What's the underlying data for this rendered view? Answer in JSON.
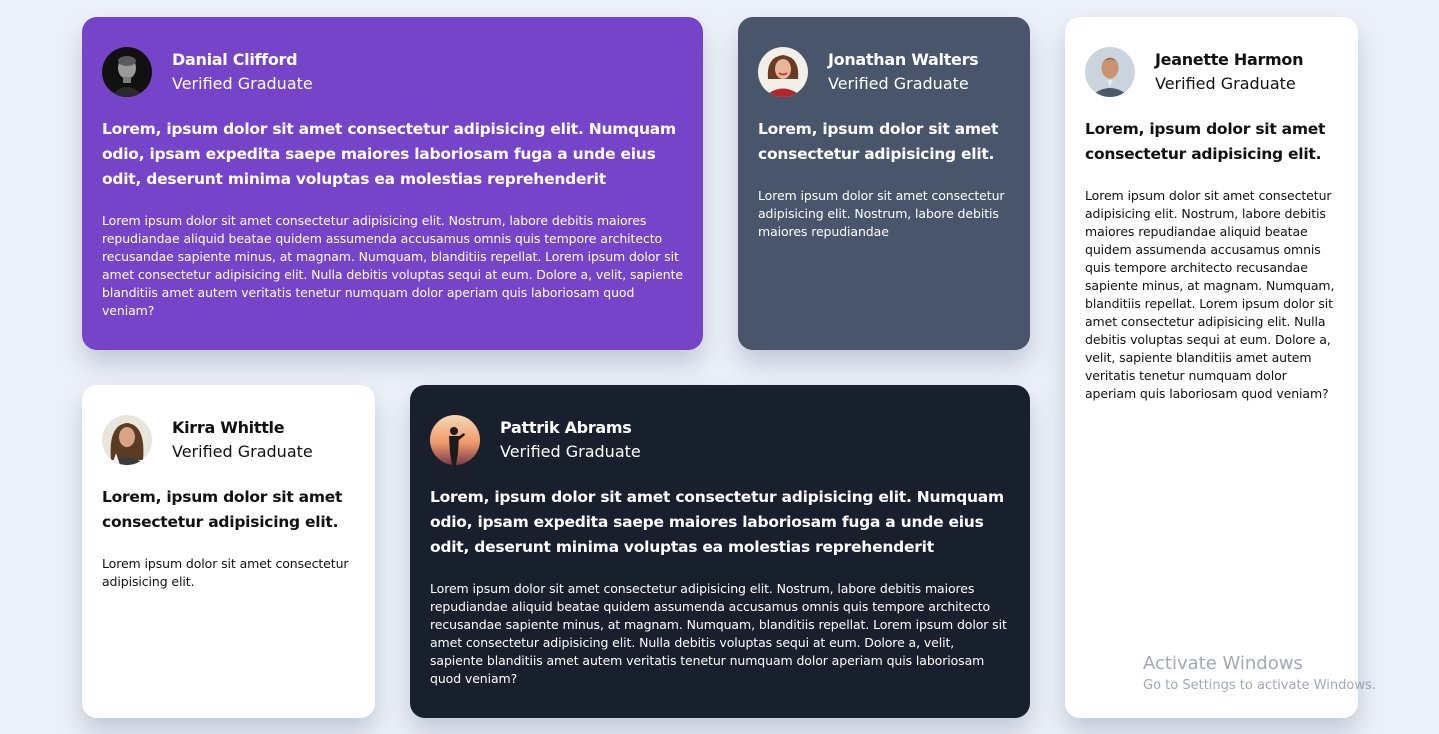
{
  "testimonials": [
    {
      "name": "Danial Clifford",
      "role": "Verified Graduate",
      "quote": "Lorem, ipsum dolor sit amet consectetur adipisicing elit. Numquam odio, ipsam expedita saepe maiores laboriosam fuga a unde eius odit, deserunt minima voluptas ea molestias reprehenderit",
      "body": "Lorem ipsum dolor sit amet consectetur adipisicing elit. Nostrum, labore debitis maiores repudiandae aliquid beatae quidem assumenda accusamus omnis quis tempore architecto recusandae sapiente minus, at magnam. Numquam, blanditiis repellat. Lorem ipsum dolor sit amet consectetur adipisicing elit. Nulla debitis voluptas sequi at eum. Dolore a, velit, sapiente blanditiis amet autem veritatis tenetur numquam dolor aperiam quis laboriosam quod veniam?",
      "background": "#7544c9"
    },
    {
      "name": "Jonathan Walters",
      "role": "Verified Graduate",
      "quote": "Lorem, ipsum dolor sit amet consectetur adipisicing elit.",
      "body": "Lorem ipsum dolor sit amet consectetur adipisicing elit. Nostrum, labore debitis maiores repudiandae",
      "background": "#48556a"
    },
    {
      "name": "Jeanette Harmon",
      "role": "Verified Graduate",
      "quote": "Lorem, ipsum dolor sit amet consectetur adipisicing elit.",
      "body": "Lorem ipsum dolor sit amet consectetur adipisicing elit. Nostrum, labore debitis maiores repudiandae aliquid beatae quidem assumenda accusamus omnis quis tempore architecto recusandae sapiente minus, at magnam. Numquam, blanditiis repellat. Lorem ipsum dolor sit amet consectetur adipisicing elit. Nulla debitis voluptas sequi at eum. Dolore a, velit, sapiente blanditiis amet autem veritatis tenetur numquam dolor aperiam quis laboriosam quod veniam?",
      "background": "#ffffff"
    },
    {
      "name": "Kirra Whittle",
      "role": "Verified Graduate",
      "quote": "Lorem, ipsum dolor sit amet consectetur adipisicing elit.",
      "body": "Lorem ipsum dolor sit amet consectetur adipisicing elit.",
      "background": "#ffffff"
    },
    {
      "name": "Pattrik Abrams",
      "role": "Verified Graduate",
      "quote": "Lorem, ipsum dolor sit amet consectetur adipisicing elit. Numquam odio, ipsam expedita saepe maiores laboriosam fuga a unde eius odit, deserunt minima voluptas ea molestias reprehenderit",
      "body": "Lorem ipsum dolor sit amet consectetur adipisicing elit. Nostrum, labore debitis maiores repudiandae aliquid beatae quidem assumenda accusamus omnis quis tempore architecto recusandae sapiente minus, at magnam. Numquam, blanditiis repellat. Lorem ipsum dolor sit amet consectetur adipisicing elit. Nulla debitis voluptas sequi at eum. Dolore a, velit, sapiente blanditiis amet autem veritatis tenetur numquam dolor aperiam quis laboriosam quod veniam?",
      "background": "#19202d"
    }
  ],
  "watermark": {
    "title": "Activate Windows",
    "subtitle": "Go to Settings to activate Windows."
  },
  "colors": {
    "page_background": "#ecf0f8",
    "purple": "#7544c9",
    "slate": "#48556a",
    "dark": "#19202d",
    "white": "#ffffff"
  }
}
